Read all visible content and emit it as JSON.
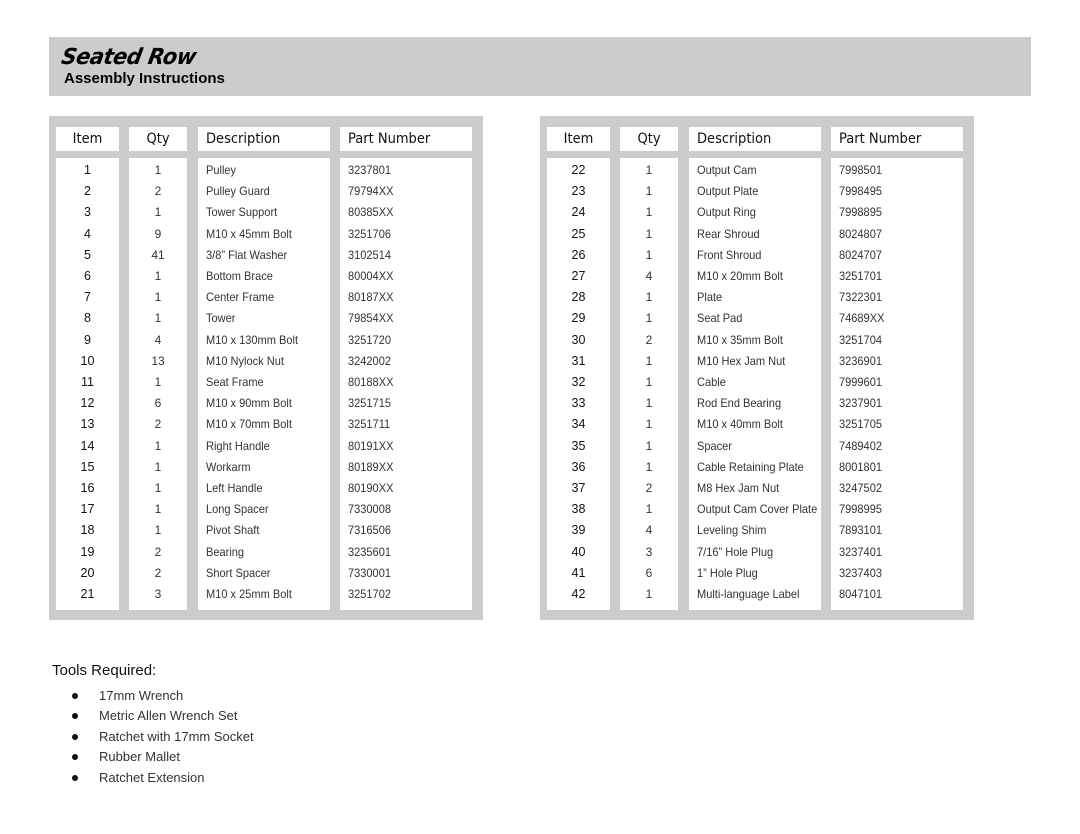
{
  "header": {
    "brand_title": "Seated Row",
    "subtitle": "Assembly Instructions"
  },
  "parts_table_columns": {
    "item": "Item",
    "qty": "Qty",
    "description": "Description",
    "part_number": "Part Number"
  },
  "parts_left": [
    {
      "item": "1",
      "qty": "1",
      "description": "Pulley",
      "part_number": "3237801"
    },
    {
      "item": "2",
      "qty": "2",
      "description": "Pulley Guard",
      "part_number": "79794XX"
    },
    {
      "item": "3",
      "qty": "1",
      "description": "Tower Support",
      "part_number": "80385XX"
    },
    {
      "item": "4",
      "qty": "9",
      "description": "M10 x 45mm Bolt",
      "part_number": "3251706"
    },
    {
      "item": "5",
      "qty": "41",
      "description": "3/8” Flat Washer",
      "part_number": "3102514"
    },
    {
      "item": "6",
      "qty": "1",
      "description": "Bottom Brace",
      "part_number": "80004XX"
    },
    {
      "item": "7",
      "qty": "1",
      "description": "Center Frame",
      "part_number": "80187XX"
    },
    {
      "item": "8",
      "qty": "1",
      "description": "Tower",
      "part_number": "79854XX"
    },
    {
      "item": "9",
      "qty": "4",
      "description": "M10 x 130mm Bolt",
      "part_number": "3251720"
    },
    {
      "item": "10",
      "qty": "13",
      "description": "M10 Nylock Nut",
      "part_number": "3242002"
    },
    {
      "item": "11",
      "qty": "1",
      "description": "Seat Frame",
      "part_number": "80188XX"
    },
    {
      "item": "12",
      "qty": "6",
      "description": "M10 x 90mm Bolt",
      "part_number": "3251715"
    },
    {
      "item": "13",
      "qty": "2",
      "description": "M10 x 70mm Bolt",
      "part_number": "3251711"
    },
    {
      "item": "14",
      "qty": "1",
      "description": "Right Handle",
      "part_number": "80191XX"
    },
    {
      "item": "15",
      "qty": "1",
      "description": "Workarm",
      "part_number": "80189XX"
    },
    {
      "item": "16",
      "qty": "1",
      "description": "Left Handle",
      "part_number": "80190XX"
    },
    {
      "item": "17",
      "qty": "1",
      "description": "Long Spacer",
      "part_number": "7330008"
    },
    {
      "item": "18",
      "qty": "1",
      "description": "Pivot Shaft",
      "part_number": "7316506"
    },
    {
      "item": "19",
      "qty": "2",
      "description": "Bearing",
      "part_number": "3235601"
    },
    {
      "item": "20",
      "qty": "2",
      "description": "Short Spacer",
      "part_number": "7330001"
    },
    {
      "item": "21",
      "qty": "3",
      "description": "M10 x 25mm Bolt",
      "part_number": "3251702"
    }
  ],
  "parts_right": [
    {
      "item": "22",
      "qty": "1",
      "description": "Output Cam",
      "part_number": "7998501"
    },
    {
      "item": "23",
      "qty": "1",
      "description": "Output Plate",
      "part_number": "7998495"
    },
    {
      "item": "24",
      "qty": "1",
      "description": "Output Ring",
      "part_number": "7998895"
    },
    {
      "item": "25",
      "qty": "1",
      "description": "Rear Shroud",
      "part_number": "8024807"
    },
    {
      "item": "26",
      "qty": "1",
      "description": "Front Shroud",
      "part_number": "8024707"
    },
    {
      "item": "27",
      "qty": "4",
      "description": "M10 x 20mm Bolt",
      "part_number": "3251701"
    },
    {
      "item": "28",
      "qty": "1",
      "description": "Plate",
      "part_number": "7322301"
    },
    {
      "item": "29",
      "qty": "1",
      "description": "Seat Pad",
      "part_number": "74689XX"
    },
    {
      "item": "30",
      "qty": "2",
      "description": "M10 x 35mm Bolt",
      "part_number": "3251704"
    },
    {
      "item": "31",
      "qty": "1",
      "description": "M10 Hex Jam Nut",
      "part_number": "3236901"
    },
    {
      "item": "32",
      "qty": "1",
      "description": "Cable",
      "part_number": "7999601"
    },
    {
      "item": "33",
      "qty": "1",
      "description": "Rod End Bearing",
      "part_number": "3237901"
    },
    {
      "item": "34",
      "qty": "1",
      "description": "M10 x 40mm Bolt",
      "part_number": "3251705"
    },
    {
      "item": "35",
      "qty": "1",
      "description": "Spacer",
      "part_number": "7489402"
    },
    {
      "item": "36",
      "qty": "1",
      "description": "Cable Retaining Plate",
      "part_number": "8001801"
    },
    {
      "item": "37",
      "qty": "2",
      "description": "M8 Hex Jam Nut",
      "part_number": "3247502"
    },
    {
      "item": "38",
      "qty": "1",
      "description": "Output Cam Cover Plate",
      "part_number": "7998995"
    },
    {
      "item": "39",
      "qty": "4",
      "description": "Leveling Shim",
      "part_number": "7893101"
    },
    {
      "item": "40",
      "qty": "3",
      "description": "7/16” Hole Plug",
      "part_number": "3237401"
    },
    {
      "item": "41",
      "qty": "6",
      "description": "1” Hole Plug",
      "part_number": "3237403"
    },
    {
      "item": "42",
      "qty": "1",
      "description": "Multi-language Label",
      "part_number": "8047101"
    }
  ],
  "tools": {
    "heading": "Tools Required:",
    "items": [
      "17mm Wrench",
      "Metric Allen Wrench Set",
      "Ratchet with 17mm Socket",
      "Rubber Mallet",
      "Ratchet Extension"
    ]
  }
}
